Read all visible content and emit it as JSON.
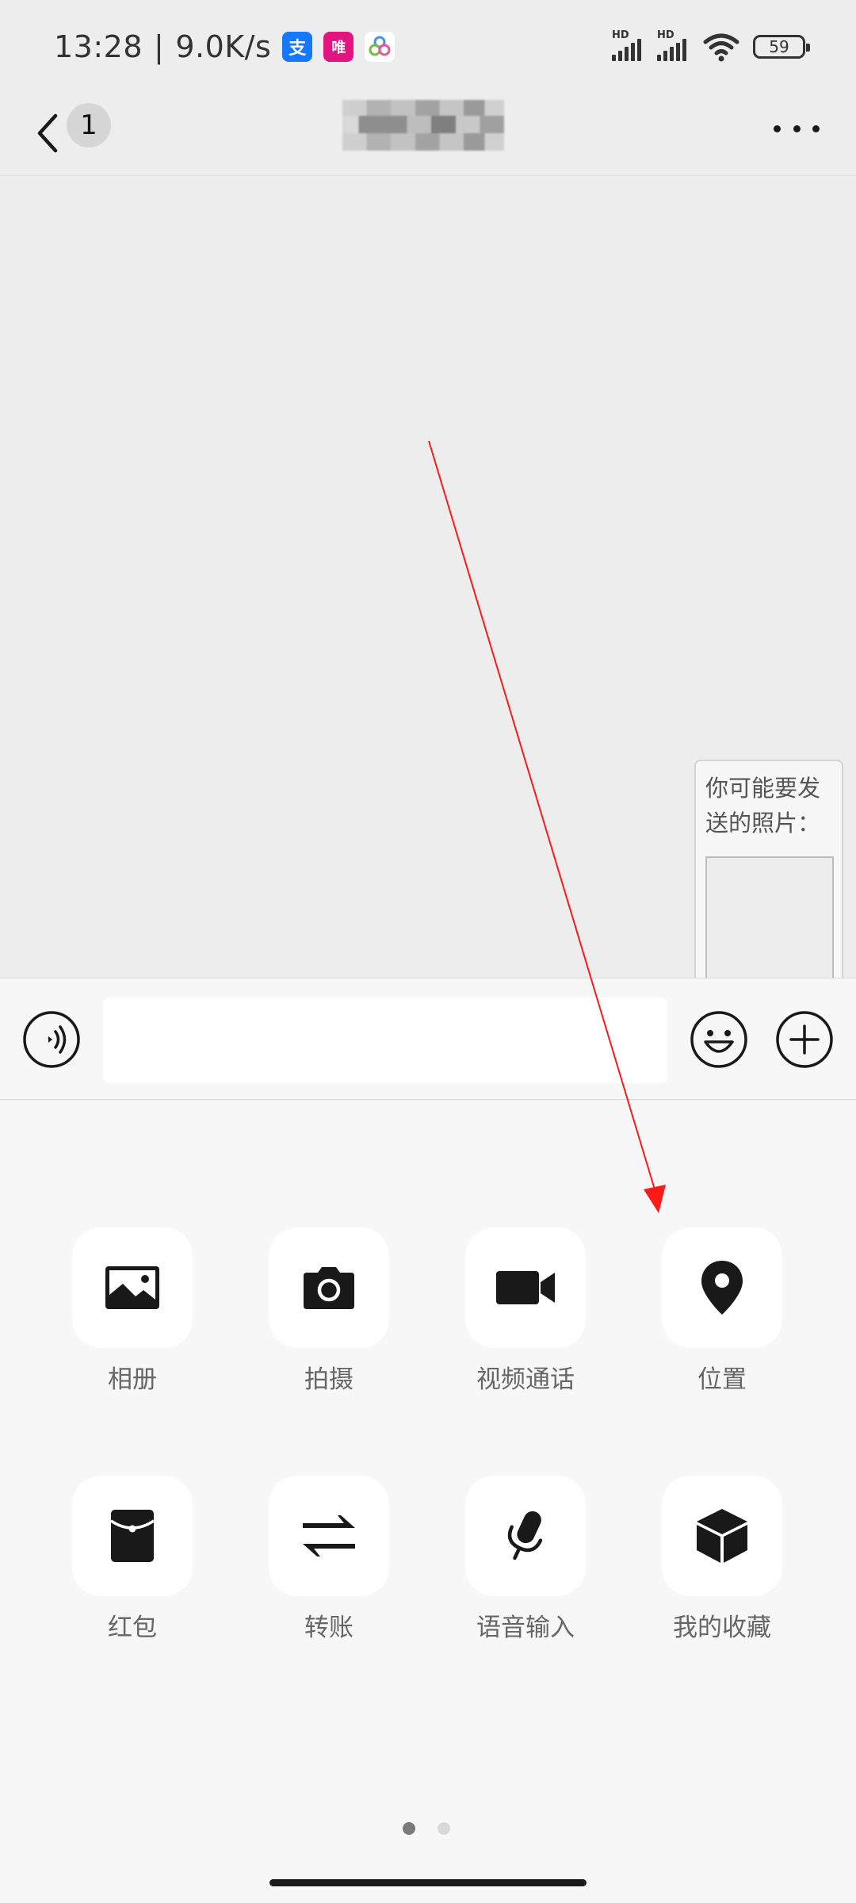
{
  "status_bar": {
    "time": "13:28",
    "separator": "|",
    "net_speed": "9.0K/s",
    "signal_1_label": "HD",
    "signal_2_label": "HD",
    "battery": "59",
    "app_icons": [
      {
        "name": "alipay-icon",
        "glyph": "支",
        "color": "#1677ff"
      },
      {
        "name": "vipshop-icon",
        "glyph": "唯",
        "color": "#e0157f"
      },
      {
        "name": "cloud-app-icon",
        "glyph": "",
        "color": "#ffffff"
      }
    ]
  },
  "nav": {
    "unread_count": "1"
  },
  "photo_tip": {
    "line1": "你可能要发",
    "line2": "送的照片："
  },
  "input": {
    "value": "",
    "placeholder": ""
  },
  "tools": [
    {
      "label": "相册",
      "icon": "album-icon"
    },
    {
      "label": "拍摄",
      "icon": "camera-icon"
    },
    {
      "label": "视频通话",
      "icon": "video-call-icon"
    },
    {
      "label": "位置",
      "icon": "location-icon"
    },
    {
      "label": "红包",
      "icon": "red-packet-icon"
    },
    {
      "label": "转账",
      "icon": "transfer-icon"
    },
    {
      "label": "语音输入",
      "icon": "voice-input-icon"
    },
    {
      "label": "我的收藏",
      "icon": "favorites-icon"
    }
  ],
  "pager": {
    "pages": 2,
    "current": 1
  },
  "colors": {
    "background": "#ededed",
    "panel": "#f7f7f7",
    "annotation_arrow": "#ff0000",
    "icon": "#191919"
  }
}
